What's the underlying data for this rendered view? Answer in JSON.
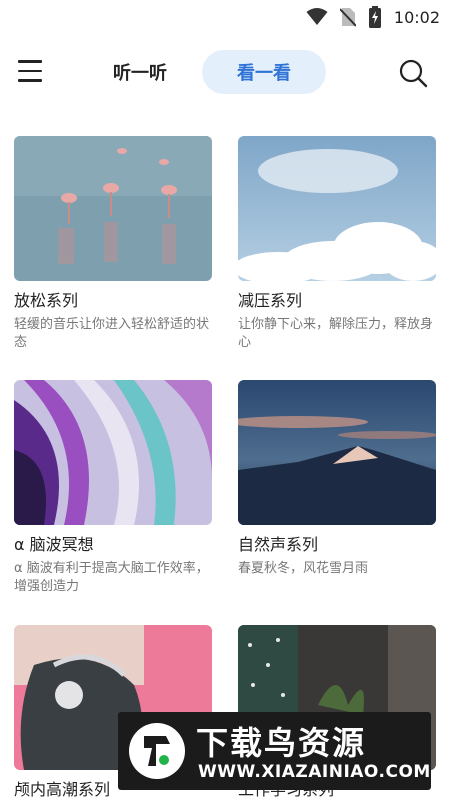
{
  "status_bar": {
    "time": "10:02",
    "icons": [
      "wifi-icon",
      "no-sim-icon",
      "battery-charging-icon"
    ]
  },
  "header": {
    "menu_icon": "menu-icon",
    "tabs": [
      {
        "label": "听一听",
        "active": false
      },
      {
        "label": "看一看",
        "active": true
      }
    ],
    "search_icon": "search-icon",
    "accent_color": "#2f73d6",
    "active_tab_bg": "#e4effc"
  },
  "cards": [
    {
      "title": "放松系列",
      "desc": "轻缓的音乐让你进入轻松舒适的状态",
      "image": "flamingos-lake"
    },
    {
      "title": "减压系列",
      "desc": "让你静下心来，解除压力，释放身心",
      "image": "blue-sky-clouds"
    },
    {
      "title": "α 脑波冥想",
      "desc": "α 脑波有利于提高大脑工作效率，增强创造力",
      "image": "purple-fluid-art"
    },
    {
      "title": "自然声系列",
      "desc": "春夏秋冬，风花雪月雨",
      "image": "mountain-dusk"
    },
    {
      "title": "颅内高潮系列",
      "desc": "",
      "image": "headphones-pink"
    },
    {
      "title": "工作学习系列",
      "desc": "",
      "image": "plants-window"
    }
  ],
  "watermark": {
    "title": "下载鸟资源",
    "url": "WWW.XIAZAINIAO.COM"
  }
}
